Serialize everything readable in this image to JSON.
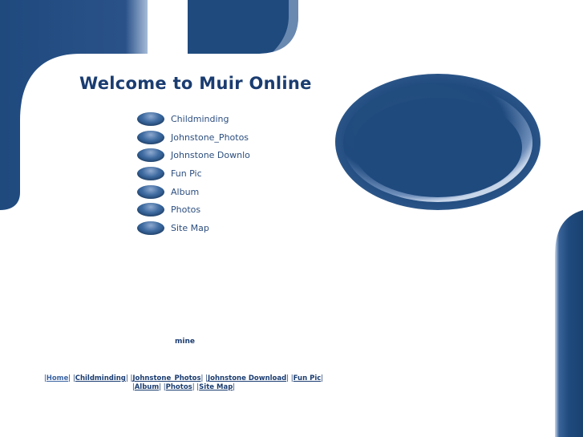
{
  "header": {
    "title": "Welcome to Muir Online"
  },
  "nav": {
    "items": [
      {
        "label": "Childminding"
      },
      {
        "label": "Johnstone_Photos"
      },
      {
        "label": "Johnstone Downlo"
      },
      {
        "label": "Fun Pic"
      },
      {
        "label": "Album"
      },
      {
        "label": "Photos"
      },
      {
        "label": "Site Map"
      }
    ]
  },
  "content": {
    "mine": "mine"
  },
  "footer": {
    "links": [
      "Home",
      "Childminding",
      "Johnstone_Photos",
      "Johnstone Download",
      "Fun Pic",
      "Album",
      "Photos",
      "Site Map"
    ]
  },
  "colors": {
    "brand": "#1f4a7e",
    "text": "#1a3c70",
    "nav_text": "#2c4e7e"
  }
}
